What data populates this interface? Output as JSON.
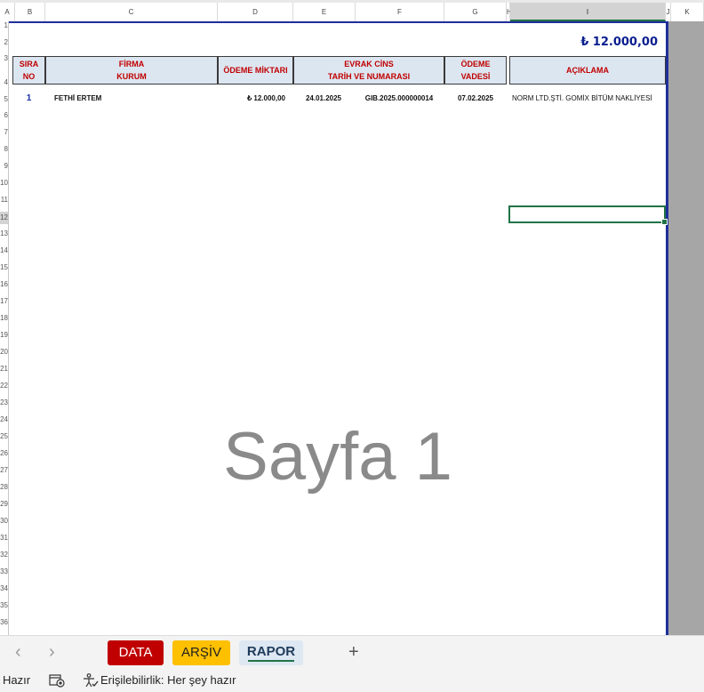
{
  "columns": [
    "A",
    "B",
    "C",
    "D",
    "E",
    "F",
    "G",
    "H",
    "I",
    "J",
    "K"
  ],
  "rows": [
    "1",
    "2",
    "3",
    "4",
    "5",
    "6",
    "7",
    "8",
    "9",
    "10",
    "11",
    "12",
    "13",
    "14",
    "15",
    "16",
    "17",
    "18",
    "19",
    "20",
    "21",
    "22",
    "23",
    "24",
    "25",
    "26",
    "27",
    "28",
    "29",
    "30",
    "31",
    "32",
    "33",
    "34",
    "35",
    "36"
  ],
  "report": {
    "total": "₺ 12.000,00",
    "headers": {
      "sira_l1": "SIRA",
      "sira_l2": "NO",
      "firma_l1": "FİRMA",
      "firma_l2": "KURUM",
      "odeme": "ÖDEME MİKTARI",
      "evrak_l1": "EVRAK CİNS",
      "evrak_l2": "TARİH VE NUMARASI",
      "vade_l1": "ÖDEME",
      "vade_l2": "VADESİ",
      "aciklama": "AÇIKLAMA"
    },
    "rows": [
      {
        "no": "1",
        "firma": "FETHİ ERTEM",
        "odeme": "₺ 12.000,00",
        "tarih": "24.01.2025",
        "numara": "GIB.2025.000000014",
        "vade": "07.02.2025",
        "aciklama": "NORM LTD.ŞTİ.  GOMİX BİTÜM NAKLİYESİ"
      }
    ]
  },
  "watermark": "Sayfa 1",
  "sheet_tabs": {
    "prev_icon": "chevron-left-icon",
    "next_icon": "chevron-right-icon",
    "tabs": [
      {
        "label": "DATA",
        "color": "#c00000"
      },
      {
        "label": "ARŞİV",
        "color": "#ffc000"
      },
      {
        "label": "RAPOR",
        "color": "#dde8f2",
        "active": true
      }
    ],
    "add_icon": "plus-icon"
  },
  "status": {
    "ready": "Hazır",
    "accessibility": "Erişilebilirlik: Her şey hazır"
  }
}
